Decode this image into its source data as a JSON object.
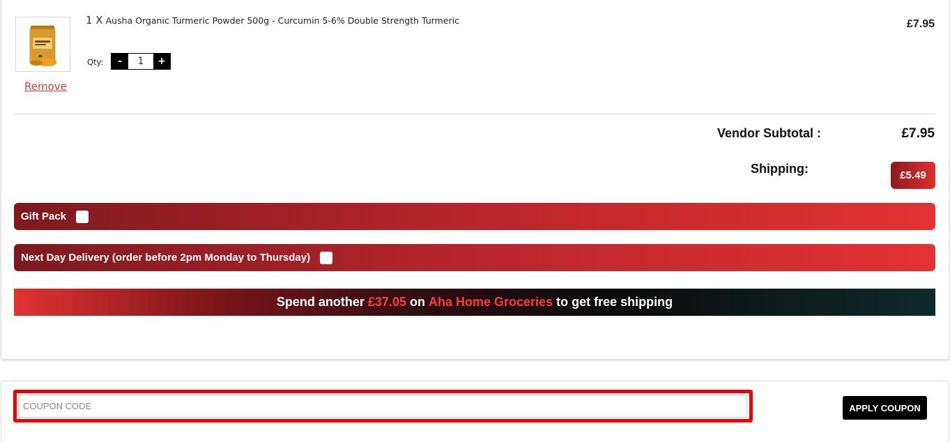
{
  "cart_item": {
    "qty_prefix": "1 X",
    "title": "Ausha Organic Turmeric Powder 500g - Curcumin 5-6% Double Strength Turmeric",
    "price": "£7.95",
    "qty_label": "Qty:",
    "qty_value": "1",
    "qty_minus": "-",
    "qty_plus": "+",
    "remove_label": "Remove",
    "image_icon": "turmeric-product-image"
  },
  "totals": {
    "subtotal_label": "Vendor Subtotal :",
    "subtotal_value": "£7.95",
    "shipping_label": "Shipping:",
    "shipping_value": "£5.49"
  },
  "options": {
    "gift_pack_label": "Gift Pack",
    "gift_pack_checked": false,
    "next_day_label": "Next Day Delivery (order before 2pm Monday to Thursday)",
    "next_day_checked": false
  },
  "promo": {
    "prefix": "Spend another",
    "amount": "£37.05",
    "middle": "on",
    "store": "Aha Home Groceries",
    "suffix": "to get free shipping"
  },
  "coupon": {
    "placeholder": "COUPON CODE",
    "value": "",
    "apply_label": "APPLY COUPON"
  },
  "colors": {
    "accent_red": "#e33232",
    "dark_red": "#7d1a1f",
    "highlight_frame": "#ee0000",
    "remove_link": "#d43a3a"
  }
}
